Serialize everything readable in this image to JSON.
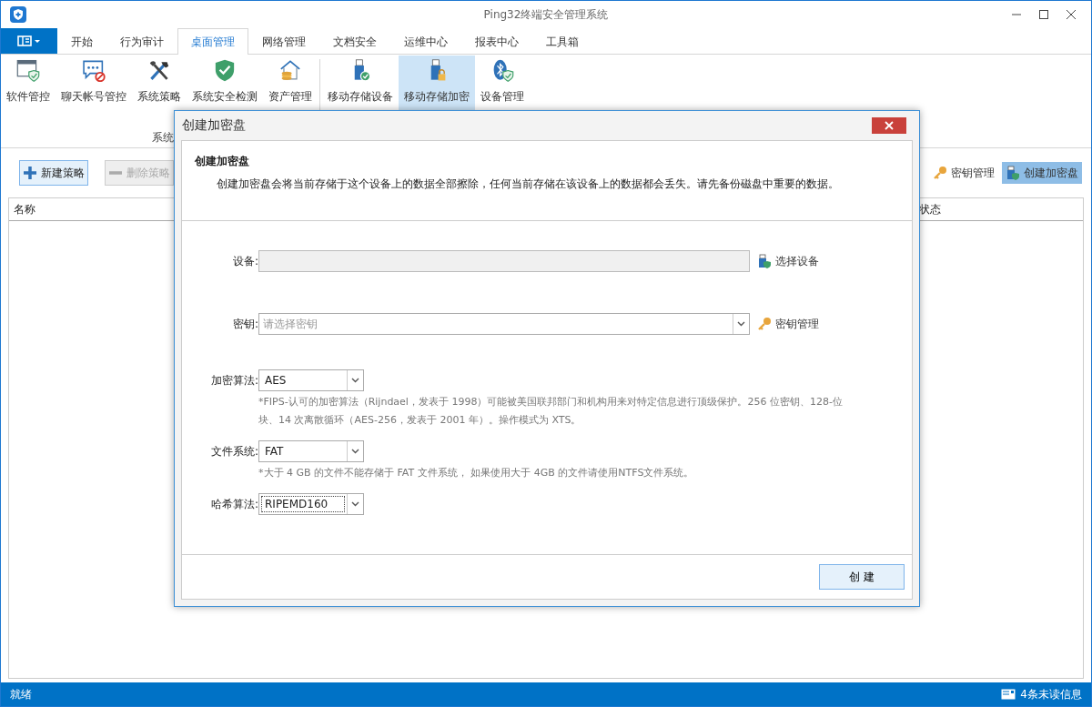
{
  "window": {
    "title": "Ping32终端安全管理系统"
  },
  "menu_tabs": [
    {
      "label": "开始",
      "selected": false
    },
    {
      "label": "行为审计",
      "selected": false
    },
    {
      "label": "桌面管理",
      "selected": true
    },
    {
      "label": "网络管理",
      "selected": false
    },
    {
      "label": "文档安全",
      "selected": false
    },
    {
      "label": "运维中心",
      "selected": false
    },
    {
      "label": "报表中心",
      "selected": false
    },
    {
      "label": "工具箱",
      "selected": false
    }
  ],
  "ribbon": {
    "groups": [
      {
        "label": "系统",
        "buttons": [
          {
            "label": "软件管控",
            "selected": false
          },
          {
            "label": "聊天帐号管控",
            "selected": false
          },
          {
            "label": "系统策略",
            "selected": false
          },
          {
            "label": "系统安全检测",
            "selected": false
          },
          {
            "label": "资产管理",
            "selected": false
          }
        ]
      },
      {
        "buttons": [
          {
            "label": "移动存储设备",
            "selected": false
          },
          {
            "label": "移动存储加密",
            "selected": true
          },
          {
            "label": "设备管理",
            "selected": false
          }
        ]
      }
    ]
  },
  "toolbar": {
    "left": [
      {
        "label": "新建策略",
        "disabled": false
      },
      {
        "label": "删除策略",
        "disabled": true
      }
    ],
    "right": [
      {
        "label": "密钥管理",
        "selected": false
      },
      {
        "label": "创建加密盘",
        "selected": true
      }
    ]
  },
  "table": {
    "columns": [
      {
        "label": "名称"
      },
      {
        "label": "状态"
      }
    ]
  },
  "dialog": {
    "title": "创建加密盘",
    "heading": "创建加密盘",
    "description": "创建加密盘会将当前存储于这个设备上的数据全部擦除，任何当前存储在该设备上的数据都会丢失。请先备份磁盘中重要的数据。",
    "fields": [
      {
        "kind": "text",
        "label": "设备:",
        "disabled": true,
        "action": "选择设备"
      },
      {
        "kind": "combo",
        "label": "密钥:",
        "placeholder": "请选择密钥",
        "focused": false,
        "action": "密钥管理"
      },
      {
        "kind": "select",
        "label": "加密算法:",
        "value": "AES",
        "focused": false,
        "note": "*FIPS-认可的加密算法（Rijndael，发表于 1998）可能被美国联邦部门和机构用来对特定信息进行顶级保护。256 位密钥、128-位块、14 次离散循环（AES-256，发表于 2001 年）。操作模式为 XTS。"
      },
      {
        "kind": "select",
        "label": "文件系统:",
        "value": "FAT",
        "focused": false,
        "note": "*大于 4 GB 的文件不能存储于 FAT 文件系统， 如果使用大于 4GB 的文件请使用NTFS文件系统。"
      },
      {
        "kind": "select",
        "label": "哈希算法:",
        "value": "RIPEMD160",
        "focused": true
      }
    ],
    "button": "创 建"
  },
  "status_bar": {
    "status": "就绪",
    "messages": "4条未读信息"
  }
}
